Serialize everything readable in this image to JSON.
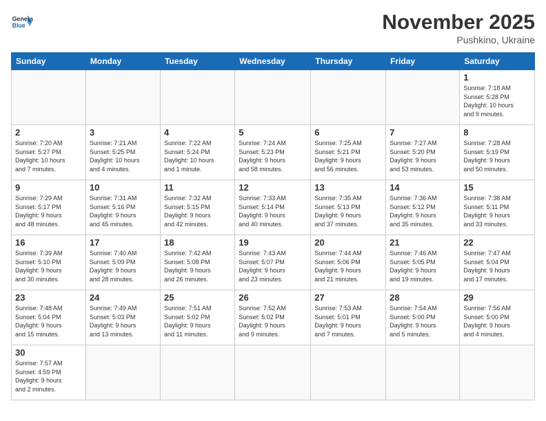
{
  "header": {
    "logo_general": "General",
    "logo_blue": "Blue",
    "month_year": "November 2025",
    "location": "Pushkino, Ukraine"
  },
  "weekdays": [
    "Sunday",
    "Monday",
    "Tuesday",
    "Wednesday",
    "Thursday",
    "Friday",
    "Saturday"
  ],
  "weeks": [
    [
      {
        "day": "",
        "info": ""
      },
      {
        "day": "",
        "info": ""
      },
      {
        "day": "",
        "info": ""
      },
      {
        "day": "",
        "info": ""
      },
      {
        "day": "",
        "info": ""
      },
      {
        "day": "",
        "info": ""
      },
      {
        "day": "1",
        "info": "Sunrise: 7:18 AM\nSunset: 5:28 PM\nDaylight: 10 hours\nand 9 minutes."
      }
    ],
    [
      {
        "day": "2",
        "info": "Sunrise: 7:20 AM\nSunset: 5:27 PM\nDaylight: 10 hours\nand 7 minutes."
      },
      {
        "day": "3",
        "info": "Sunrise: 7:21 AM\nSunset: 5:25 PM\nDaylight: 10 hours\nand 4 minutes."
      },
      {
        "day": "4",
        "info": "Sunrise: 7:22 AM\nSunset: 5:24 PM\nDaylight: 10 hours\nand 1 minute."
      },
      {
        "day": "5",
        "info": "Sunrise: 7:24 AM\nSunset: 5:23 PM\nDaylight: 9 hours\nand 58 minutes."
      },
      {
        "day": "6",
        "info": "Sunrise: 7:25 AM\nSunset: 5:21 PM\nDaylight: 9 hours\nand 56 minutes."
      },
      {
        "day": "7",
        "info": "Sunrise: 7:27 AM\nSunset: 5:20 PM\nDaylight: 9 hours\nand 53 minutes."
      },
      {
        "day": "8",
        "info": "Sunrise: 7:28 AM\nSunset: 5:19 PM\nDaylight: 9 hours\nand 50 minutes."
      }
    ],
    [
      {
        "day": "9",
        "info": "Sunrise: 7:29 AM\nSunset: 5:17 PM\nDaylight: 9 hours\nand 48 minutes."
      },
      {
        "day": "10",
        "info": "Sunrise: 7:31 AM\nSunset: 5:16 PM\nDaylight: 9 hours\nand 45 minutes."
      },
      {
        "day": "11",
        "info": "Sunrise: 7:32 AM\nSunset: 5:15 PM\nDaylight: 9 hours\nand 42 minutes."
      },
      {
        "day": "12",
        "info": "Sunrise: 7:33 AM\nSunset: 5:14 PM\nDaylight: 9 hours\nand 40 minutes."
      },
      {
        "day": "13",
        "info": "Sunrise: 7:35 AM\nSunset: 5:13 PM\nDaylight: 9 hours\nand 37 minutes."
      },
      {
        "day": "14",
        "info": "Sunrise: 7:36 AM\nSunset: 5:12 PM\nDaylight: 9 hours\nand 35 minutes."
      },
      {
        "day": "15",
        "info": "Sunrise: 7:38 AM\nSunset: 5:11 PM\nDaylight: 9 hours\nand 33 minutes."
      }
    ],
    [
      {
        "day": "16",
        "info": "Sunrise: 7:39 AM\nSunset: 5:10 PM\nDaylight: 9 hours\nand 30 minutes."
      },
      {
        "day": "17",
        "info": "Sunrise: 7:40 AM\nSunset: 5:09 PM\nDaylight: 9 hours\nand 28 minutes."
      },
      {
        "day": "18",
        "info": "Sunrise: 7:42 AM\nSunset: 5:08 PM\nDaylight: 9 hours\nand 26 minutes."
      },
      {
        "day": "19",
        "info": "Sunrise: 7:43 AM\nSunset: 5:07 PM\nDaylight: 9 hours\nand 23 minutes."
      },
      {
        "day": "20",
        "info": "Sunrise: 7:44 AM\nSunset: 5:06 PM\nDaylight: 9 hours\nand 21 minutes."
      },
      {
        "day": "21",
        "info": "Sunrise: 7:46 AM\nSunset: 5:05 PM\nDaylight: 9 hours\nand 19 minutes."
      },
      {
        "day": "22",
        "info": "Sunrise: 7:47 AM\nSunset: 5:04 PM\nDaylight: 9 hours\nand 17 minutes."
      }
    ],
    [
      {
        "day": "23",
        "info": "Sunrise: 7:48 AM\nSunset: 5:04 PM\nDaylight: 9 hours\nand 15 minutes."
      },
      {
        "day": "24",
        "info": "Sunrise: 7:49 AM\nSunset: 5:03 PM\nDaylight: 9 hours\nand 13 minutes."
      },
      {
        "day": "25",
        "info": "Sunrise: 7:51 AM\nSunset: 5:02 PM\nDaylight: 9 hours\nand 11 minutes."
      },
      {
        "day": "26",
        "info": "Sunrise: 7:52 AM\nSunset: 5:02 PM\nDaylight: 9 hours\nand 9 minutes."
      },
      {
        "day": "27",
        "info": "Sunrise: 7:53 AM\nSunset: 5:01 PM\nDaylight: 9 hours\nand 7 minutes."
      },
      {
        "day": "28",
        "info": "Sunrise: 7:54 AM\nSunset: 5:00 PM\nDaylight: 9 hours\nand 5 minutes."
      },
      {
        "day": "29",
        "info": "Sunrise: 7:56 AM\nSunset: 5:00 PM\nDaylight: 9 hours\nand 4 minutes."
      }
    ],
    [
      {
        "day": "30",
        "info": "Sunrise: 7:57 AM\nSunset: 4:59 PM\nDaylight: 9 hours\nand 2 minutes."
      },
      {
        "day": "",
        "info": ""
      },
      {
        "day": "",
        "info": ""
      },
      {
        "day": "",
        "info": ""
      },
      {
        "day": "",
        "info": ""
      },
      {
        "day": "",
        "info": ""
      },
      {
        "day": "",
        "info": ""
      }
    ]
  ]
}
